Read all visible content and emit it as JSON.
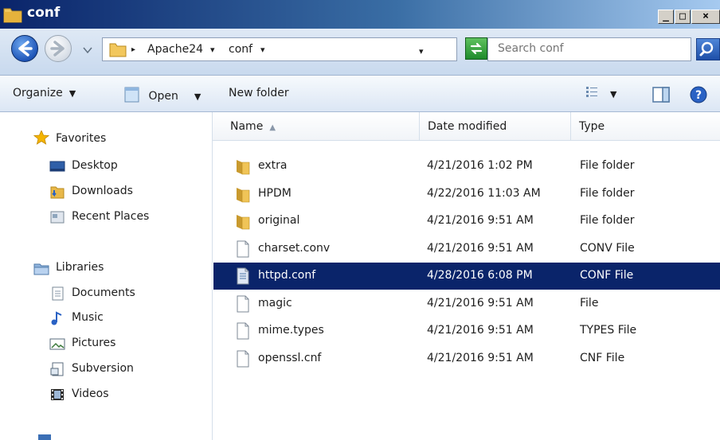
{
  "window": {
    "title": "conf"
  },
  "titlebar_buttons": {
    "minimize": "_",
    "maximize": "□",
    "close": "×"
  },
  "address": {
    "crumbs": [
      "Apache24",
      "conf"
    ],
    "separator": "▸",
    "dropdown": "▾"
  },
  "search": {
    "placeholder": "Search conf"
  },
  "toolbar": {
    "organize": "Organize",
    "open": "Open",
    "new_folder": "New folder"
  },
  "nav": {
    "favorites": {
      "header": "Favorites",
      "items": [
        "Desktop",
        "Downloads",
        "Recent Places"
      ]
    },
    "libraries": {
      "header": "Libraries",
      "items": [
        "Documents",
        "Music",
        "Pictures",
        "Subversion",
        "Videos"
      ]
    }
  },
  "columns": {
    "name": "Name",
    "date": "Date modified",
    "type": "Type"
  },
  "files": [
    {
      "name": "extra",
      "date": "4/21/2016 1:02 PM",
      "type": "File folder",
      "icon": "folder-icon"
    },
    {
      "name": "HPDM",
      "date": "4/22/2016 11:03 AM",
      "type": "File folder",
      "icon": "folder-icon"
    },
    {
      "name": "original",
      "date": "4/21/2016 9:51 AM",
      "type": "File folder",
      "icon": "folder-icon"
    },
    {
      "name": "charset.conv",
      "date": "4/21/2016 9:51 AM",
      "type": "CONV File",
      "icon": "file-icon"
    },
    {
      "name": "httpd.conf",
      "date": "4/28/2016 6:08 PM",
      "type": "CONF File",
      "icon": "file-icon",
      "selected": true
    },
    {
      "name": "magic",
      "date": "4/21/2016 9:51 AM",
      "type": "File",
      "icon": "file-icon"
    },
    {
      "name": "mime.types",
      "date": "4/21/2016 9:51 AM",
      "type": "TYPES File",
      "icon": "file-icon"
    },
    {
      "name": "openssl.cnf",
      "date": "4/21/2016 9:51 AM",
      "type": "CNF File",
      "icon": "file-icon"
    }
  ],
  "colors": {
    "selection": "#0a246a",
    "titlebar": "#0a246a",
    "folder": "#e8b84a"
  }
}
